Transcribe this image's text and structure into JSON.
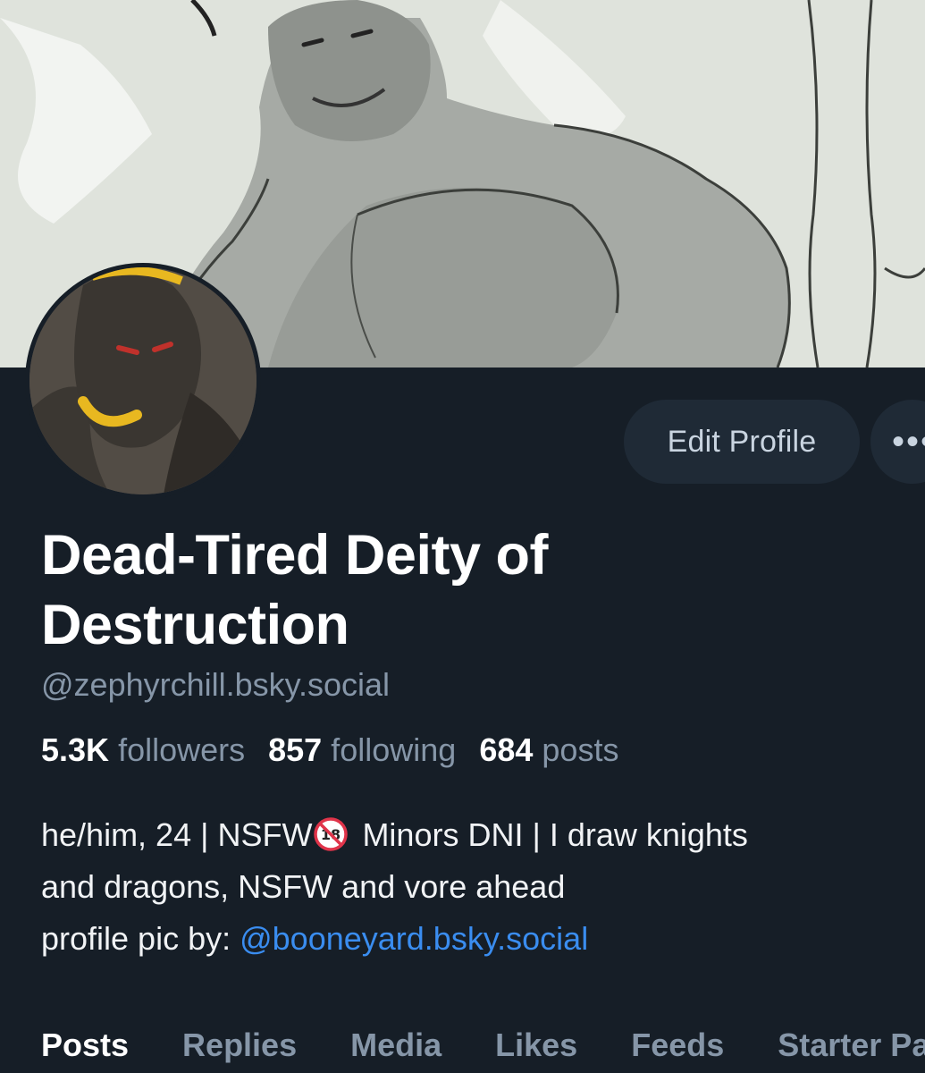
{
  "profile": {
    "display_name": "Dead-Tired Deity of Destruction",
    "handle": "@zephyrchill.bsky.social"
  },
  "actions": {
    "edit_profile_label": "Edit Profile",
    "more_label": "•••"
  },
  "stats": {
    "followers_count": "5.3K",
    "followers_label": "followers",
    "following_count": "857",
    "following_label": "following",
    "posts_count": "684",
    "posts_label": "posts"
  },
  "bio": {
    "line1_before": "he/him, 24 | NSFW",
    "line1_after": " Minors DNI | I draw knights",
    "line2": "and dragons, NSFW and vore ahead",
    "line3_prefix": "profile pic by: ",
    "line3_link": "@booneyard.bsky.social",
    "nsfw_icon": "no-one-under-eighteen-emoji"
  },
  "tabs": [
    "Posts",
    "Replies",
    "Media",
    "Likes",
    "Feeds",
    "Starter Packs"
  ],
  "active_tab": "Posts",
  "colors": {
    "background": "#161e27",
    "button_bg": "#1f2a36",
    "muted_text": "#8696a8",
    "link": "#3a8df0"
  }
}
